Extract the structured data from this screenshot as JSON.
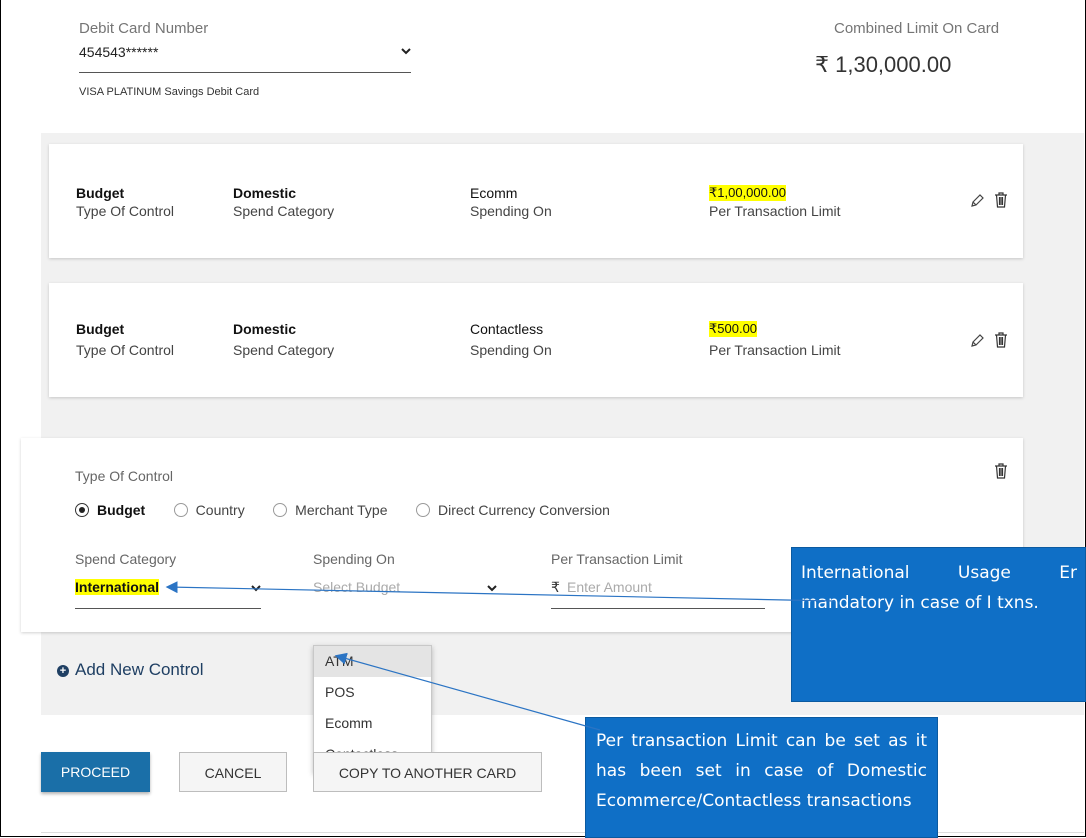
{
  "header": {
    "debit_card_label": "Debit Card Number",
    "debit_card_value": "454543******",
    "card_type": "VISA PLATINUM Savings Debit Card",
    "combined_limit_label": "Combined Limit On Card",
    "combined_limit_value": "₹ 1,30,000.00"
  },
  "controls": [
    {
      "type": "Budget",
      "type_label": "Type Of Control",
      "category": "Domestic",
      "category_label": "Spend Category",
      "spending_on": "Ecomm",
      "spending_on_label": "Spending On",
      "limit": "₹1,00,000.00",
      "limit_label": "Per Transaction Limit"
    },
    {
      "type": "Budget",
      "type_label": "Type Of Control",
      "category": "Domestic",
      "category_label": "Spend Category",
      "spending_on": "Contactless",
      "spending_on_label": "Spending On",
      "limit": "₹500.00",
      "limit_label": "Per Transaction Limit"
    }
  ],
  "new_control": {
    "type_label": "Type Of Control",
    "options": [
      "Budget",
      "Country",
      "Merchant Type",
      "Direct Currency Conversion"
    ],
    "selected": "Budget",
    "spend_category_label": "Spend Category",
    "spend_category_value": "International",
    "spending_on_label": "Spending On",
    "spending_on_placeholder": "Select Budget",
    "limit_label": "Per Transaction Limit",
    "currency_symbol": "₹",
    "limit_placeholder": "Enter Amount"
  },
  "dropdown_options": [
    "ATM",
    "POS",
    "Ecomm",
    "Contactless"
  ],
  "add_control": "Add New Control",
  "buttons": {
    "proceed": "PROCEED",
    "cancel": "CANCEL",
    "copy": "COPY TO ANOTHER CARD"
  },
  "callouts": {
    "international": "International Usage Er mandatory in case of I txns.",
    "limit": "Per transaction Limit can be set as it has been set in case of Domestic Ecommerce/Contactless transactions"
  },
  "colors": {
    "primary": "#1a6fa8",
    "callout": "#0f6fc6",
    "highlight": "#ffff00"
  }
}
